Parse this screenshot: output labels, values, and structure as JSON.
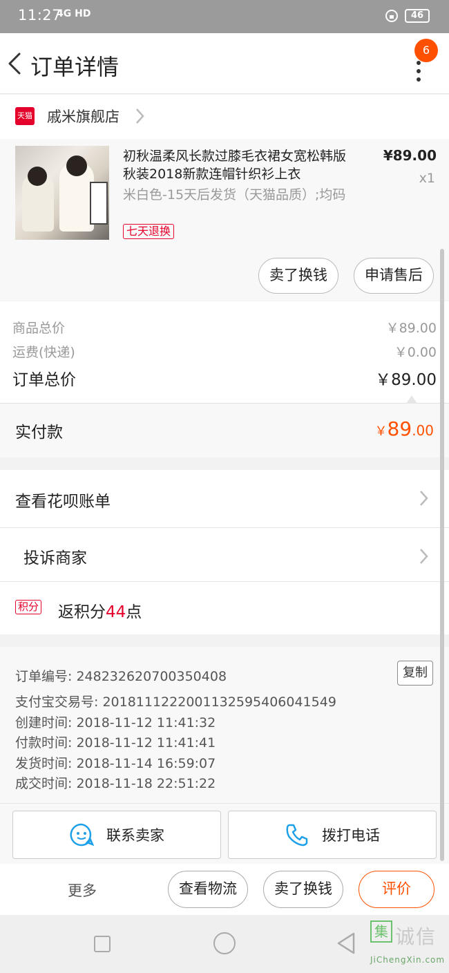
{
  "status_bar": {
    "time": "11:27",
    "network": "4G HD",
    "battery": "46"
  },
  "nav": {
    "title": "订单详情",
    "badge_count": "6"
  },
  "shop": {
    "logo_text": "天猫",
    "name": "戚米旗舰店"
  },
  "product": {
    "title": "初秋温柔风长款过膝毛衣裙女宽松韩版秋装2018新款连帽针织衫上衣",
    "sku": "米白色-15天后发货（天猫品质）;均码",
    "return_tag": "七天退换",
    "price": "¥89.00",
    "quantity": "x1",
    "buttons": {
      "sell_exchange": "卖了换钱",
      "after_sale": "申请售后"
    }
  },
  "price_summary": {
    "goods_label": "商品总价",
    "goods_value": "￥89.00",
    "shipping_label": "运费(快递)",
    "shipping_value": "￥0.00",
    "order_label": "订单总价",
    "order_value": "￥89.00"
  },
  "paid": {
    "label": "实付款",
    "currency": "￥",
    "integer": "89",
    "decimal": ".00"
  },
  "menu": {
    "huabei": "查看花呗账单",
    "complain": "投诉商家",
    "points_tag": "积分",
    "points_prefix": "返积分",
    "points_value": "44",
    "points_suffix": "点"
  },
  "order_info": {
    "order_no": "订单编号: 248232620700350408",
    "alipay_no": "支付宝交易号: 2018111222001132595406041549",
    "created": "创建时间: 2018-11-12 11:41:32",
    "paid_time": "付款时间: 2018-11-12 11:41:41",
    "shipped": "发货时间: 2018-11-14 16:59:07",
    "completed": "成交时间: 2018-11-18 22:51:22",
    "copy_label": "复制"
  },
  "contact": {
    "seller": "联系卖家",
    "phone": "拨打电话"
  },
  "bottom_bar": {
    "more": "更多",
    "logistics": "查看物流",
    "sell_exchange": "卖了换钱",
    "review": "评价"
  },
  "watermark": {
    "box_char": "集",
    "chars": "诚信",
    "url": "JiChengXin.com"
  },
  "colors": {
    "accent": "#ff5000",
    "tmall_red": "#e4002b",
    "icon_blue": "#1ea0e8"
  }
}
